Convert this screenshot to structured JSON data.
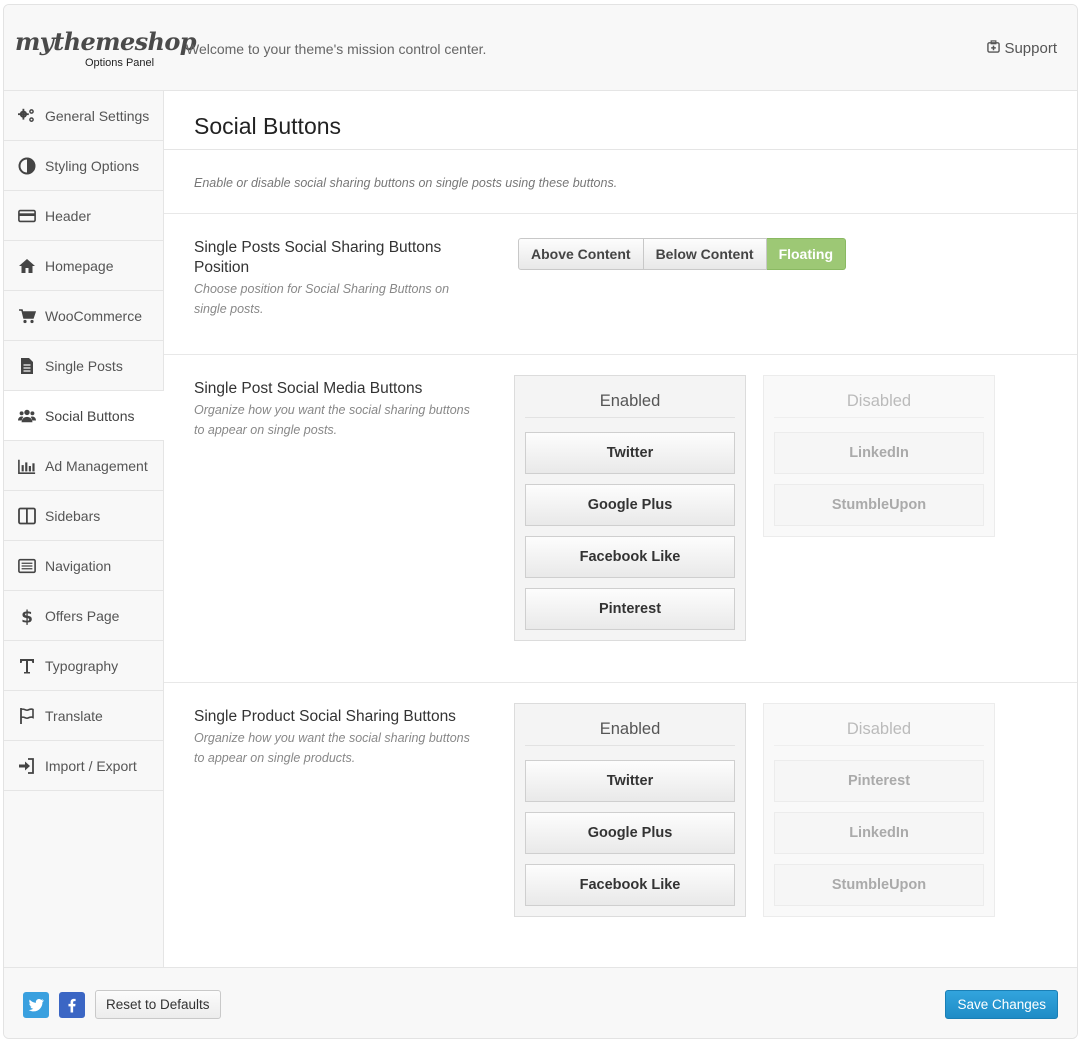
{
  "header": {
    "logo_text": "mythemeshop",
    "logo_subtitle": "Options Panel",
    "welcome": "Welcome to your theme's mission control center.",
    "support_label": "Support"
  },
  "sidebar": {
    "items": [
      {
        "label": "General Settings",
        "icon": "gears-icon"
      },
      {
        "label": "Styling Options",
        "icon": "contrast-icon"
      },
      {
        "label": "Header",
        "icon": "credit-card-icon"
      },
      {
        "label": "Homepage",
        "icon": "home-icon"
      },
      {
        "label": "WooCommerce",
        "icon": "cart-icon"
      },
      {
        "label": "Single Posts",
        "icon": "document-icon"
      },
      {
        "label": "Social Buttons",
        "icon": "users-icon",
        "active": true
      },
      {
        "label": "Ad Management",
        "icon": "bar-chart-icon"
      },
      {
        "label": "Sidebars",
        "icon": "columns-icon"
      },
      {
        "label": "Navigation",
        "icon": "list-icon"
      },
      {
        "label": "Offers Page",
        "icon": "dollar-icon"
      },
      {
        "label": "Typography",
        "icon": "text-icon"
      },
      {
        "label": "Translate",
        "icon": "flag-icon"
      },
      {
        "label": "Import / Export",
        "icon": "sign-in-icon"
      }
    ]
  },
  "main": {
    "title": "Social Buttons",
    "intro": "Enable or disable social sharing buttons on single posts using these buttons.",
    "position_option": {
      "label": "Single Posts Social Sharing Buttons Position",
      "description": "Choose position for Social Sharing Buttons on single posts.",
      "choices": [
        "Above Content",
        "Below Content",
        "Floating"
      ],
      "selected": "Floating"
    },
    "post_buttons": {
      "label": "Single Post Social Media Buttons",
      "description": "Organize how you want the social sharing buttons to appear on single posts.",
      "enabled_title": "Enabled",
      "disabled_title": "Disabled",
      "enabled": [
        "Twitter",
        "Google Plus",
        "Facebook Like",
        "Pinterest"
      ],
      "disabled": [
        "LinkedIn",
        "StumbleUpon"
      ]
    },
    "product_buttons": {
      "label": "Single Product Social Sharing Buttons",
      "description": "Organize how you want the social sharing buttons to appear on single products.",
      "enabled_title": "Enabled",
      "disabled_title": "Disabled",
      "enabled": [
        "Twitter",
        "Google Plus",
        "Facebook Like"
      ],
      "disabled": [
        "Pinterest",
        "LinkedIn",
        "StumbleUpon"
      ]
    }
  },
  "footer": {
    "reset_label": "Reset to Defaults",
    "save_label": "Save Changes"
  },
  "colors": {
    "selected_green": "#9dc875",
    "save_blue": "#2596d1",
    "twitter_blue": "#3aa0df",
    "facebook_blue": "#3b66c4"
  }
}
